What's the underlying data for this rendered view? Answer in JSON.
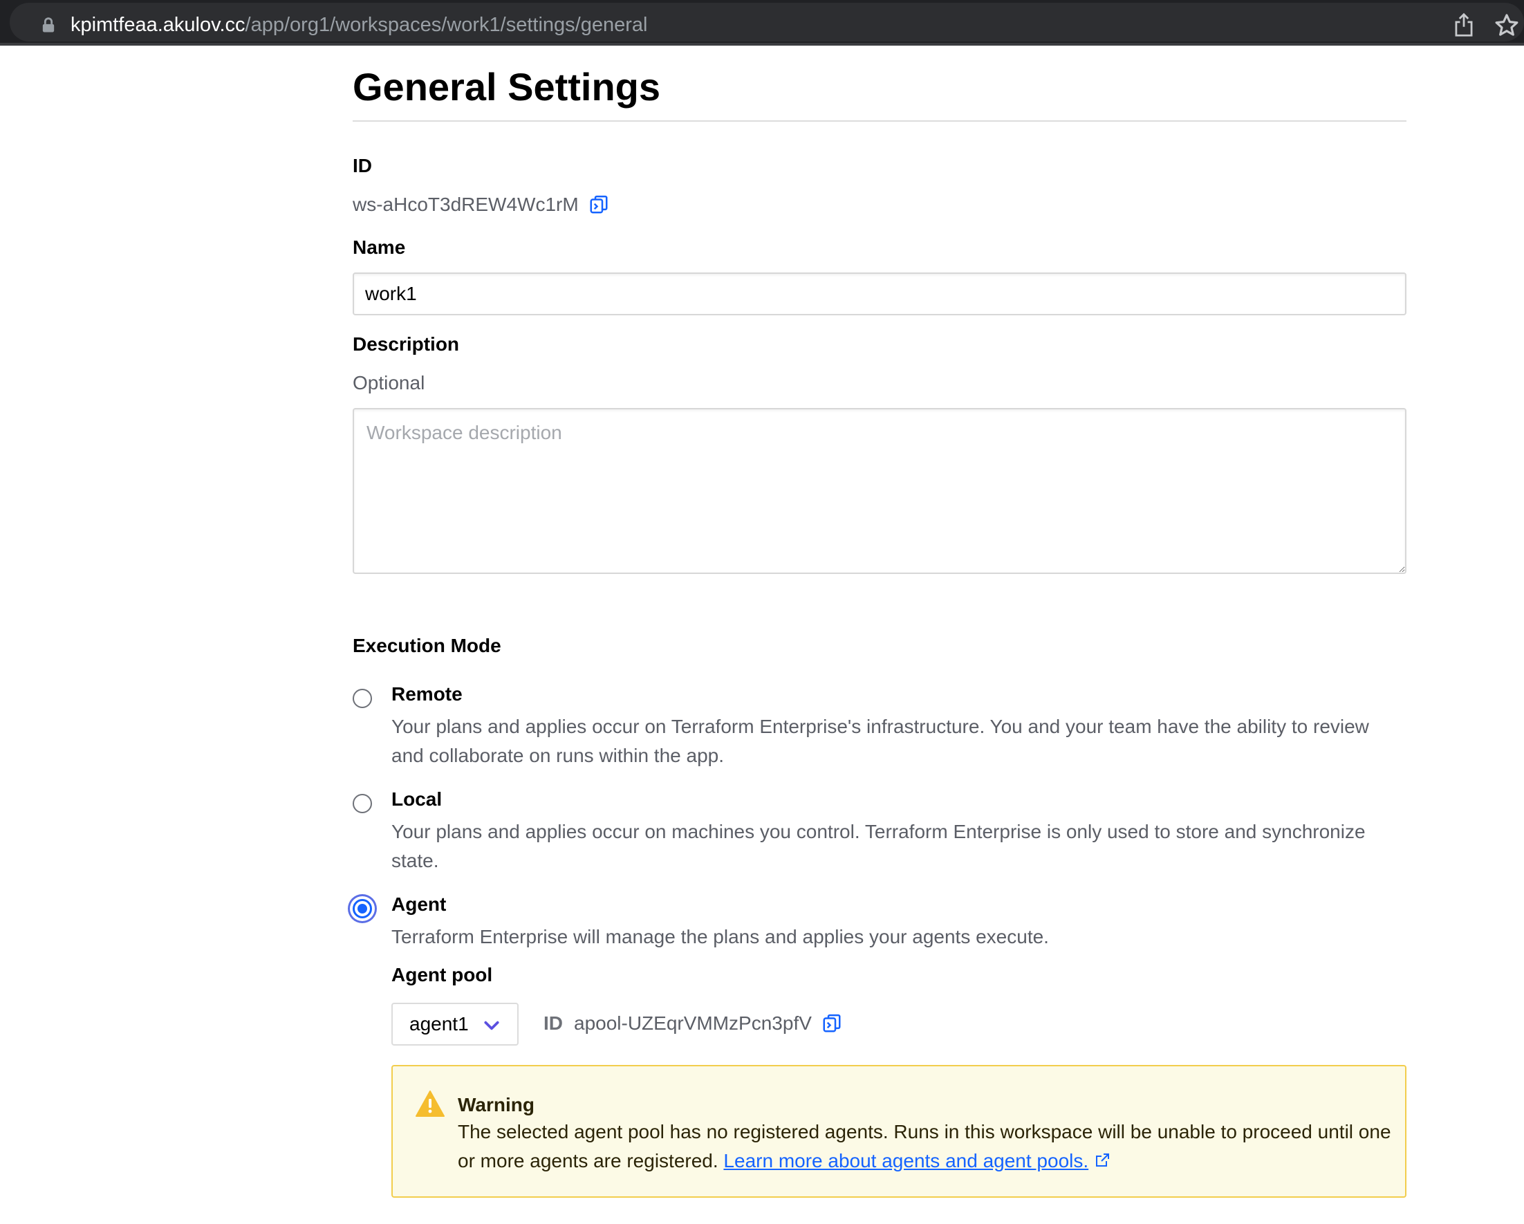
{
  "browser": {
    "url_host": "kpimtfeaa.akulov.cc",
    "url_path": "/app/org1/workspaces/work1/settings/general"
  },
  "page": {
    "title": "General Settings"
  },
  "id_section": {
    "label": "ID",
    "value": "ws-aHcoT3dREW4Wc1rM"
  },
  "name_section": {
    "label": "Name",
    "value": "work1"
  },
  "description_section": {
    "label": "Description",
    "hint": "Optional",
    "placeholder": "Workspace description"
  },
  "execution_mode": {
    "label": "Execution Mode",
    "selected": "Agent",
    "options": [
      {
        "title": "Remote",
        "description": "Your plans and applies occur on Terraform Enterprise's infrastructure. You and your team have the ability to review and collaborate on runs within the app."
      },
      {
        "title": "Local",
        "description": "Your plans and applies occur on machines you control. Terraform Enterprise is only used to store and synchronize state."
      },
      {
        "title": "Agent",
        "description": "Terraform Enterprise will manage the plans and applies your agents execute."
      }
    ]
  },
  "agent_pool": {
    "label": "Agent pool",
    "selected": "agent1",
    "id_label": "ID",
    "id_value": "apool-UZEqrVMMzPcn3pfV"
  },
  "warning": {
    "title": "Warning",
    "text": "The selected agent pool has no registered agents. Runs in this workspace will be unable to proceed until one or more agents are registered.",
    "link_text": "Learn more about agents and agent pools."
  },
  "colors": {
    "accent": "#1563ff",
    "warning_bg": "#fcfae6",
    "warning_border": "#f2cd4d",
    "browser_bar": "#202124"
  }
}
